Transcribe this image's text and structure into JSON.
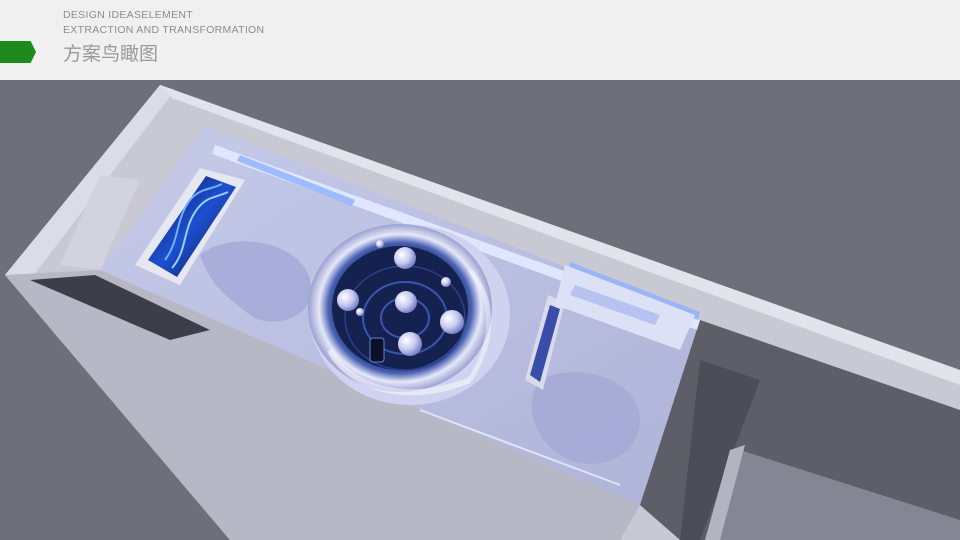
{
  "header": {
    "subtitle_line1": "DESIGN IDEASELEMENT",
    "subtitle_line2": "EXTRACTION AND TRANSFORMATION",
    "title": "方案鸟瞰图",
    "accent_color": "#1e8a1e"
  },
  "render": {
    "description_icon": "exhibition-hall-aerial-render",
    "background_color": "#6e6f79"
  }
}
